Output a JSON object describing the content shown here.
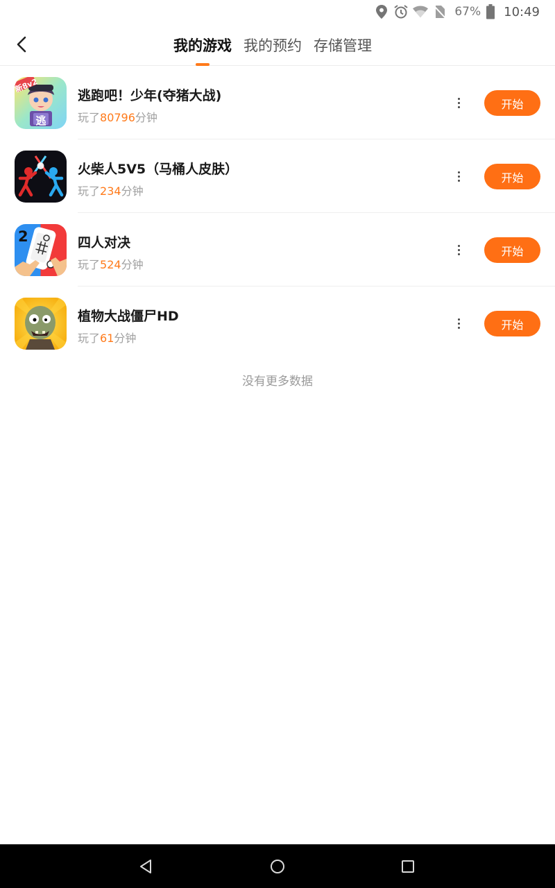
{
  "status_bar": {
    "icons": [
      "location-icon",
      "alarm-icon",
      "wifi-icon",
      "no-sim-icon",
      "battery-icon"
    ],
    "battery": "67%",
    "time": "10:49"
  },
  "header": {
    "tabs": [
      {
        "label": "我的游戏",
        "active": true
      },
      {
        "label": "我的预约",
        "active": false
      },
      {
        "label": "存储管理",
        "active": false
      }
    ]
  },
  "games": [
    {
      "name": "逃跑吧！少年(夺猪大战)",
      "prefix": "玩了",
      "minutes": "80796",
      "suffix": "分钟",
      "button": "开始",
      "icon": "escape-game-icon",
      "icon_badge": "新8v2",
      "icon_glyph": "逃"
    },
    {
      "name": "火柴人5V5（马桶人皮肤）",
      "prefix": "玩了",
      "minutes": "234",
      "suffix": "分钟",
      "button": "开始",
      "icon": "stickman-game-icon"
    },
    {
      "name": "四人对决",
      "prefix": "玩了",
      "minutes": "524",
      "suffix": "分钟",
      "button": "开始",
      "icon": "four-player-game-icon",
      "icon_glyph": "2"
    },
    {
      "name": "植物大战僵尸HD",
      "prefix": "玩了",
      "minutes": "61",
      "suffix": "分钟",
      "button": "开始",
      "icon": "zombie-game-icon"
    }
  ],
  "footer_text": "没有更多数据",
  "colors": {
    "accent": "#ff6f14",
    "highlight": "#ff7a1a"
  }
}
